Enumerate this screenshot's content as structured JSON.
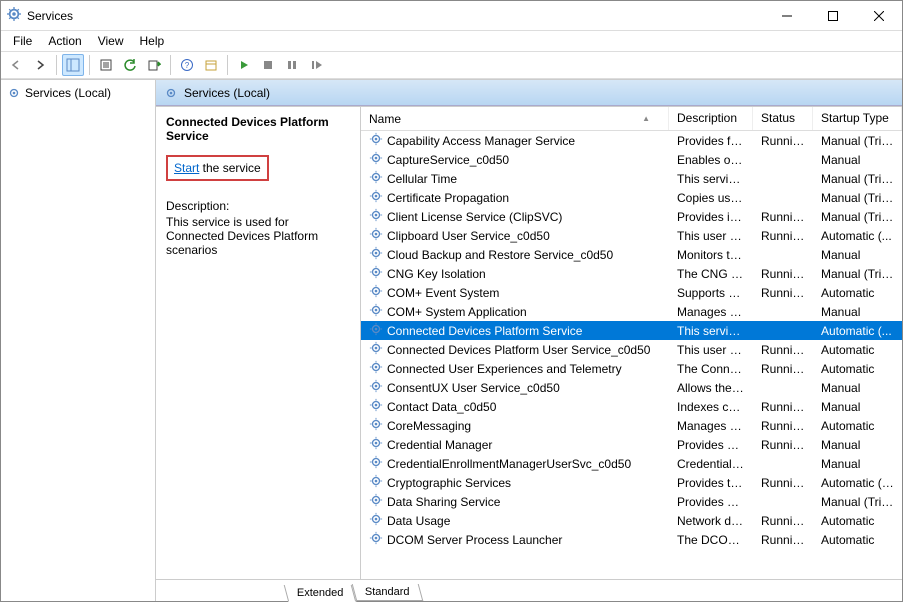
{
  "window": {
    "title": "Services"
  },
  "menubar": [
    "File",
    "Action",
    "View",
    "Help"
  ],
  "leftpane": {
    "node": "Services (Local)"
  },
  "rightheader": {
    "title": "Services (Local)"
  },
  "detail": {
    "service_name": "Connected Devices Platform Service",
    "start_link": "Start",
    "start_suffix": " the service",
    "desc_label": "Description:",
    "desc_text": "This service is used for Connected Devices Platform scenarios"
  },
  "columns": {
    "name": "Name",
    "description": "Description",
    "status": "Status",
    "startup": "Startup Type"
  },
  "tabs": {
    "extended": "Extended",
    "standard": "Standard"
  },
  "services": [
    {
      "name": "Capability Access Manager Service",
      "desc": "Provides fac...",
      "status": "Running",
      "startup": "Manual (Trig...",
      "selected": false
    },
    {
      "name": "CaptureService_c0d50",
      "desc": "Enables opti...",
      "status": "",
      "startup": "Manual",
      "selected": false
    },
    {
      "name": "Cellular Time",
      "desc": "This service ...",
      "status": "",
      "startup": "Manual (Trig...",
      "selected": false
    },
    {
      "name": "Certificate Propagation",
      "desc": "Copies user ...",
      "status": "",
      "startup": "Manual (Trig...",
      "selected": false
    },
    {
      "name": "Client License Service (ClipSVC)",
      "desc": "Provides inf...",
      "status": "Running",
      "startup": "Manual (Trig...",
      "selected": false
    },
    {
      "name": "Clipboard User Service_c0d50",
      "desc": "This user ser...",
      "status": "Running",
      "startup": "Automatic (...",
      "selected": false
    },
    {
      "name": "Cloud Backup and Restore Service_c0d50",
      "desc": "Monitors th...",
      "status": "",
      "startup": "Manual",
      "selected": false
    },
    {
      "name": "CNG Key Isolation",
      "desc": "The CNG ke...",
      "status": "Running",
      "startup": "Manual (Trig...",
      "selected": false
    },
    {
      "name": "COM+ Event System",
      "desc": "Supports Sy...",
      "status": "Running",
      "startup": "Automatic",
      "selected": false
    },
    {
      "name": "COM+ System Application",
      "desc": "Manages th...",
      "status": "",
      "startup": "Manual",
      "selected": false
    },
    {
      "name": "Connected Devices Platform Service",
      "desc": "This service ...",
      "status": "",
      "startup": "Automatic (...",
      "selected": true
    },
    {
      "name": "Connected Devices Platform User Service_c0d50",
      "desc": "This user ser...",
      "status": "Running",
      "startup": "Automatic",
      "selected": false
    },
    {
      "name": "Connected User Experiences and Telemetry",
      "desc": "The Connec...",
      "status": "Running",
      "startup": "Automatic",
      "selected": false
    },
    {
      "name": "ConsentUX User Service_c0d50",
      "desc": "Allows the s...",
      "status": "",
      "startup": "Manual",
      "selected": false
    },
    {
      "name": "Contact Data_c0d50",
      "desc": "Indexes con...",
      "status": "Running",
      "startup": "Manual",
      "selected": false
    },
    {
      "name": "CoreMessaging",
      "desc": "Manages co...",
      "status": "Running",
      "startup": "Automatic",
      "selected": false
    },
    {
      "name": "Credential Manager",
      "desc": "Provides se...",
      "status": "Running",
      "startup": "Manual",
      "selected": false
    },
    {
      "name": "CredentialEnrollmentManagerUserSvc_c0d50",
      "desc": "Credential E...",
      "status": "",
      "startup": "Manual",
      "selected": false
    },
    {
      "name": "Cryptographic Services",
      "desc": "Provides thr...",
      "status": "Running",
      "startup": "Automatic (T...",
      "selected": false
    },
    {
      "name": "Data Sharing Service",
      "desc": "Provides da...",
      "status": "",
      "startup": "Manual (Trig...",
      "selected": false
    },
    {
      "name": "Data Usage",
      "desc": "Network da...",
      "status": "Running",
      "startup": "Automatic",
      "selected": false
    },
    {
      "name": "DCOM Server Process Launcher",
      "desc": "The DCOMl...",
      "status": "Running",
      "startup": "Automatic",
      "selected": false
    }
  ]
}
